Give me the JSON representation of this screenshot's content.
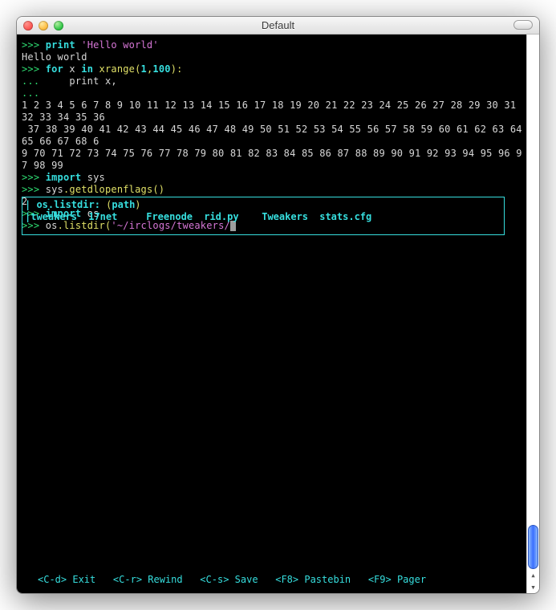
{
  "window": {
    "title": "Default"
  },
  "prompt": ">>> ",
  "continuation": "...     ",
  "lines": {
    "l1_print": "print ",
    "l1_str": "'Hello world'",
    "l2_out": "Hello world",
    "l3_for": "for ",
    "l3_var": "x ",
    "l3_in": "in ",
    "l3_fn": "xrange",
    "l3_open": "(",
    "l3_arg1": "1",
    "l3_comma": ",",
    "l3_arg2": "100",
    "l3_close": "):",
    "l4_body": "print x,",
    "l5_dots": "...",
    "l6_nums1": "1 2 3 4 5 6 7 8 9 10 11 12 13 14 15 16 17 18 19 20 21 22 23 24 25 26 27 28 29 30 31 32 33 34 35 36",
    "l7_nums2": " 37 38 39 40 41 42 43 44 45 46 47 48 49 50 51 52 53 54 55 56 57 58 59 60 61 62 63 64 65 66 67 68 6",
    "l8_nums3": "9 70 71 72 73 74 75 76 77 78 79 80 81 82 83 84 85 86 87 88 89 90 91 92 93 94 95 96 97 98 99",
    "l9_imp": "import ",
    "l9_mod": "sys",
    "l10_mod": "sys",
    "l10_dot": ".",
    "l10_fn": "getdlopenflags",
    "l10_parens": "()",
    "l11_out": "2",
    "l12_imp": "import ",
    "l12_mod": "os",
    "l13_mod": "os",
    "l13_dot": ".",
    "l13_fn": "listdir",
    "l13_open": "(",
    "l13_str": "'~/irclogs/tweakers/",
    "hint_fn": "os.listdir",
    "hint_sep": ": ",
    "hint_open": "(",
    "hint_arg": "path",
    "hint_close": ")",
    "comp1": "tweakers",
    "comp2": "17net",
    "comp3": "Freenode",
    "comp4": "rid.py",
    "comp5": "Tweakers",
    "comp6": "stats.cfg"
  },
  "status": {
    "k1": "<C-d>",
    "v1": " Exit   ",
    "k2": "<C-r>",
    "v2": " Rewind   ",
    "k3": "<C-s>",
    "v3": " Save   ",
    "k4": "<F8>",
    "v4": " Pastebin   ",
    "k5": "<F9>",
    "v5": " Pager"
  }
}
